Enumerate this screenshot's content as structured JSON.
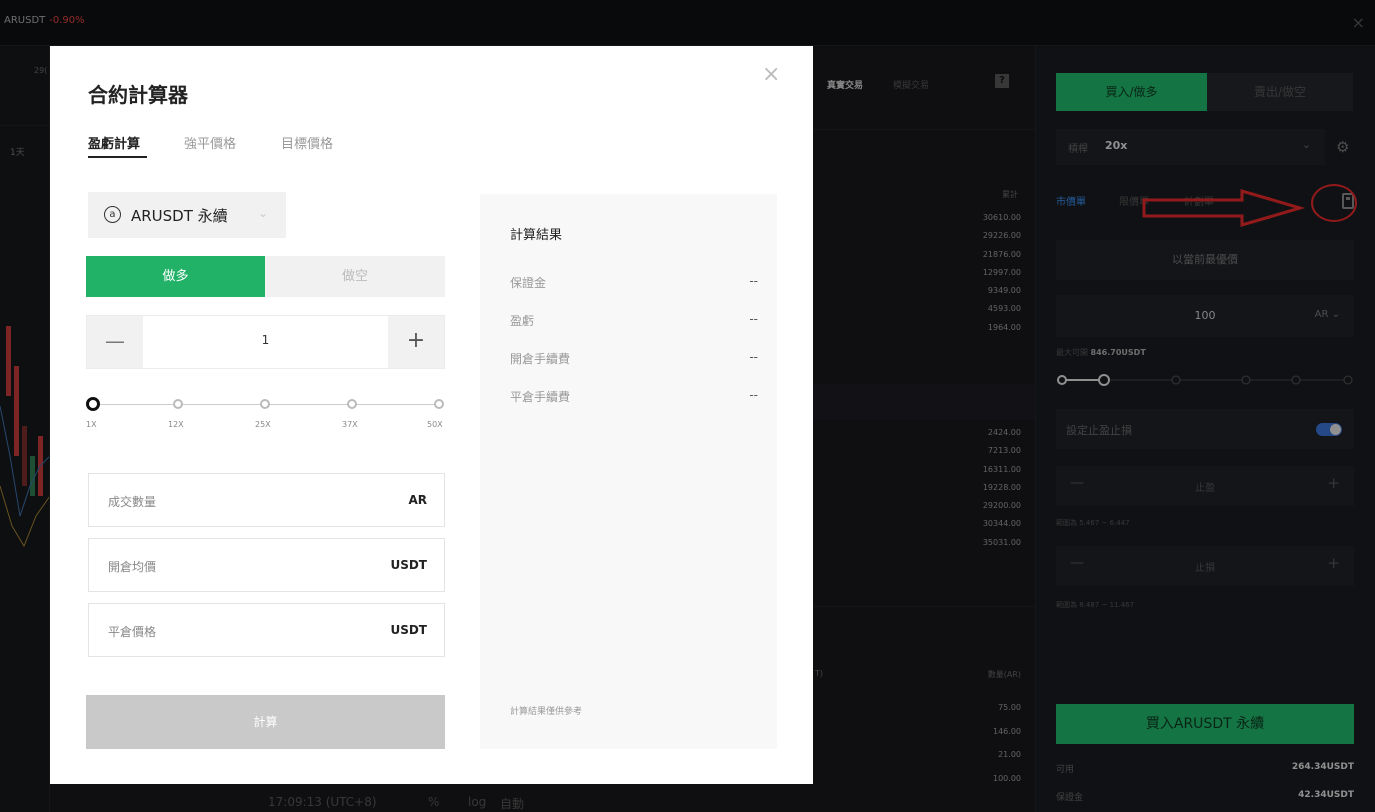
{
  "topbar": {
    "symbol": "ARUSDT",
    "change": "-0.90%"
  },
  "chart": {
    "timeframe": "1天",
    "header_text": "29("
  },
  "middle": {
    "tabs": [
      "真實交易",
      "模擬交易"
    ],
    "help_label": "?",
    "book_header": "累計",
    "asks": [
      "30610.00",
      "29226.00",
      "21876.00",
      "12997.00",
      "9349.00",
      "4593.00",
      "1964.00"
    ],
    "bids": [
      "2424.00",
      "7213.00",
      "16311.00",
      "19228.00",
      "29200.00",
      "30344.00",
      "35031.00"
    ],
    "trades_header_left": "T)",
    "trades_header": "數量(AR)",
    "trades": [
      "75.00",
      "146.00",
      "21.00",
      "100.00"
    ]
  },
  "right": {
    "buy_tab": "買入/做多",
    "sell_tab": "賣出/做空",
    "leverage_label": "槓桿",
    "leverage_value": "20x",
    "order_types": [
      "市價單",
      "限價單",
      "計劃單"
    ],
    "best_price": "以當前最優價",
    "quantity": "100",
    "quantity_unit": "AR",
    "max_label": "最大可開",
    "max_value": "846.70USDT",
    "tpsl_label": "設定止盈止損",
    "tp_label": "止盈",
    "tp_range": "範圍為 5.467 ~ 6.447",
    "sl_label": "止損",
    "sl_range": "範圍為 8.487 ~ 11.467",
    "buy_button": "買入ARUSDT 永續",
    "available_label": "可用",
    "available_value": "264.34USDT",
    "margin_label": "保證金",
    "margin_value": "42.34USDT"
  },
  "modal": {
    "title": "合約計算器",
    "close": "×",
    "tabs": [
      "盈虧計算",
      "強平價格",
      "目標價格"
    ],
    "symbol_icon": "a",
    "symbol": "ARUSDT 永續",
    "long_label": "做多",
    "short_label": "做空",
    "quantity": "1",
    "minus": "—",
    "plus": "+",
    "leverage_marks": [
      "1X",
      "12X",
      "25X",
      "37X",
      "50X"
    ],
    "fields": [
      {
        "label": "成交數量",
        "unit": "AR"
      },
      {
        "label": "開倉均價",
        "unit": "USDT"
      },
      {
        "label": "平倉價格",
        "unit": "USDT"
      }
    ],
    "calc_button": "計算",
    "result": {
      "title": "計算結果",
      "rows": [
        {
          "label": "保證金",
          "value": "--"
        },
        {
          "label": "盈虧",
          "value": "--"
        },
        {
          "label": "開倉手續費",
          "value": "--"
        },
        {
          "label": "平倉手續費",
          "value": "--"
        }
      ],
      "note": "計算結果僅供參考"
    }
  },
  "bottom": {
    "time": "17:09:13 (UTC+8)",
    "pct": "%",
    "log": "log",
    "auto": "自動"
  },
  "colors": {
    "green": "#21b268",
    "annotation_red": "#e0292a",
    "accent_blue": "#3a8be8"
  }
}
